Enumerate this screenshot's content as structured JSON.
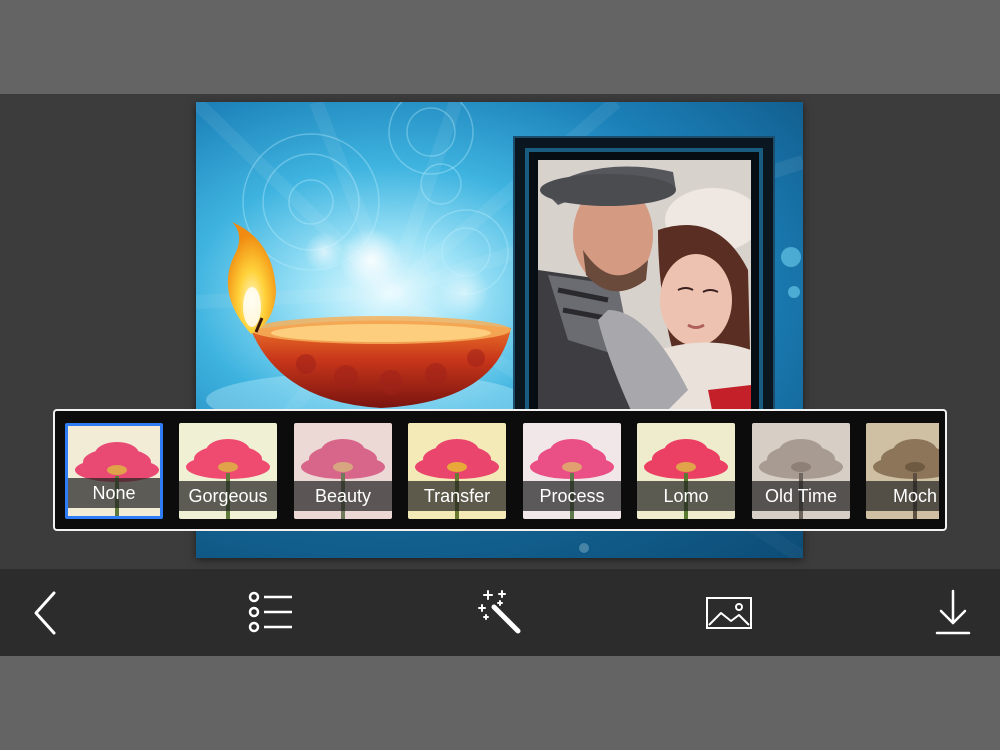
{
  "filters": [
    {
      "label": "None",
      "tint": "#f2ecd6",
      "flower": "#e84a74",
      "selected": true
    },
    {
      "label": "Gorgeous",
      "tint": "#eff0d4",
      "flower": "#ef4a70"
    },
    {
      "label": "Beauty",
      "tint": "#ecd9d6",
      "flower": "#d8668a"
    },
    {
      "label": "Transfer",
      "tint": "#f3eab8",
      "flower": "#e9456d"
    },
    {
      "label": "Process",
      "tint": "#f1e6e8",
      "flower": "#ea4f86"
    },
    {
      "label": "Lomo",
      "tint": "#efeccd",
      "flower": "#ec3f64"
    },
    {
      "label": "Old Time",
      "tint": "#d7cec6",
      "flower": "#a89b92"
    },
    {
      "label": "Moch",
      "tint": "#cfc0a4",
      "flower": "#8c7558"
    }
  ],
  "toolbar": {
    "items": [
      {
        "name": "back-button",
        "icon": "chevron-left-icon"
      },
      {
        "name": "list-button",
        "icon": "list-icon"
      },
      {
        "name": "effects-button",
        "icon": "magic-wand-icon"
      },
      {
        "name": "background-button",
        "icon": "image-icon"
      },
      {
        "name": "download-button",
        "icon": "download-icon"
      }
    ]
  },
  "colors": {
    "accent": "#2f7df4",
    "toolbar": "#2c2c2c",
    "background": "#616161"
  }
}
